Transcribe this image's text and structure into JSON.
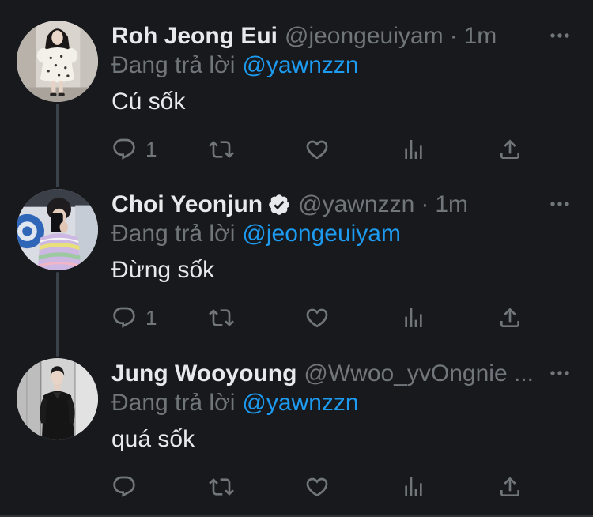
{
  "theme": {
    "background": "#17191d",
    "text_primary": "#e7e9ea",
    "text_secondary": "#71767b",
    "accent": "#1d9bf0",
    "thread_line": "#3a4148"
  },
  "icons": {
    "more": "more-horizontal-icon",
    "verified": "verified-badge-icon",
    "reply": "reply-icon",
    "retweet": "retweet-icon",
    "like": "heart-icon",
    "analytics": "analytics-icon",
    "share": "share-icon"
  },
  "tweets": [
    {
      "author": {
        "name": "Roh Jeong Eui",
        "handle": "@jeongeuiyam",
        "verified": false
      },
      "separator": "·",
      "time": "1m",
      "reply_prefix": "Đang trả lời",
      "reply_to": "@yawnzzn",
      "text": "Cú sốk",
      "reply_count": "1"
    },
    {
      "author": {
        "name": "Choi Yeonjun",
        "handle": "@yawnzzn",
        "verified": true
      },
      "separator": "·",
      "time": "1m",
      "reply_prefix": "Đang trả lời",
      "reply_to": "@jeongeuiyam",
      "text": "Đừng sốk",
      "reply_count": "1"
    },
    {
      "author": {
        "name": "Jung Wooyoung",
        "handle": "@Wwoo_yvOngnie ...",
        "verified": false
      },
      "reply_prefix": "Đang trả lời",
      "reply_to": "@yawnzzn",
      "text": "quá sốk"
    }
  ]
}
